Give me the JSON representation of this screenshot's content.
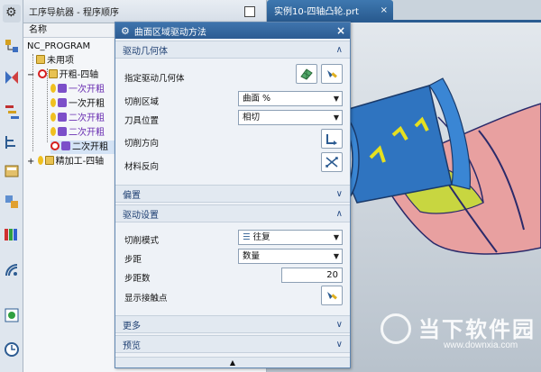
{
  "navigator": {
    "title": "工序导航器 - 程序顺序",
    "column_name": "名称",
    "tree": [
      {
        "label": "NC_PROGRAM"
      },
      {
        "label": "未用项"
      },
      {
        "label": "开粗-四轴"
      },
      {
        "label": "一次开粗"
      },
      {
        "label": "一次开粗"
      },
      {
        "label": "二次开粗"
      },
      {
        "label": "二次开粗"
      },
      {
        "label": "二次开粗"
      },
      {
        "label": "精加工-四轴"
      }
    ]
  },
  "doc_tab": {
    "label": "实例10-四轴凸轮.prt",
    "close": "×"
  },
  "dialog": {
    "title": "曲面区域驱动方法",
    "close": "×",
    "sections": {
      "drive_geometry": "驱动几何体",
      "offset": "偏置",
      "drive_settings": "驱动设置",
      "more": "更多",
      "preview": "预览"
    },
    "fields": {
      "specify_drive_geometry": "指定驱动几何体",
      "cut_area": "切削区域",
      "cut_area_value": "曲面 %",
      "tool_position": "刀具位置",
      "tool_position_value": "相切",
      "cut_direction": "切削方向",
      "material_reverse": "材料反向",
      "cut_mode": "切削模式",
      "cut_mode_value": "往复",
      "stepover": "步距",
      "stepover_value": "数量",
      "step_count": "步距数",
      "step_count_value": "20",
      "show_contact_points": "显示接触点"
    }
  },
  "watermark": {
    "name": "当下软件园",
    "url": "www.downxia.com"
  },
  "colors": {
    "accent": "#2d5c92",
    "section_text": "#1e3f72",
    "part_blue": "#2f74c0",
    "part_pink": "#e8a0a0",
    "part_yellow": "#c8d640"
  }
}
